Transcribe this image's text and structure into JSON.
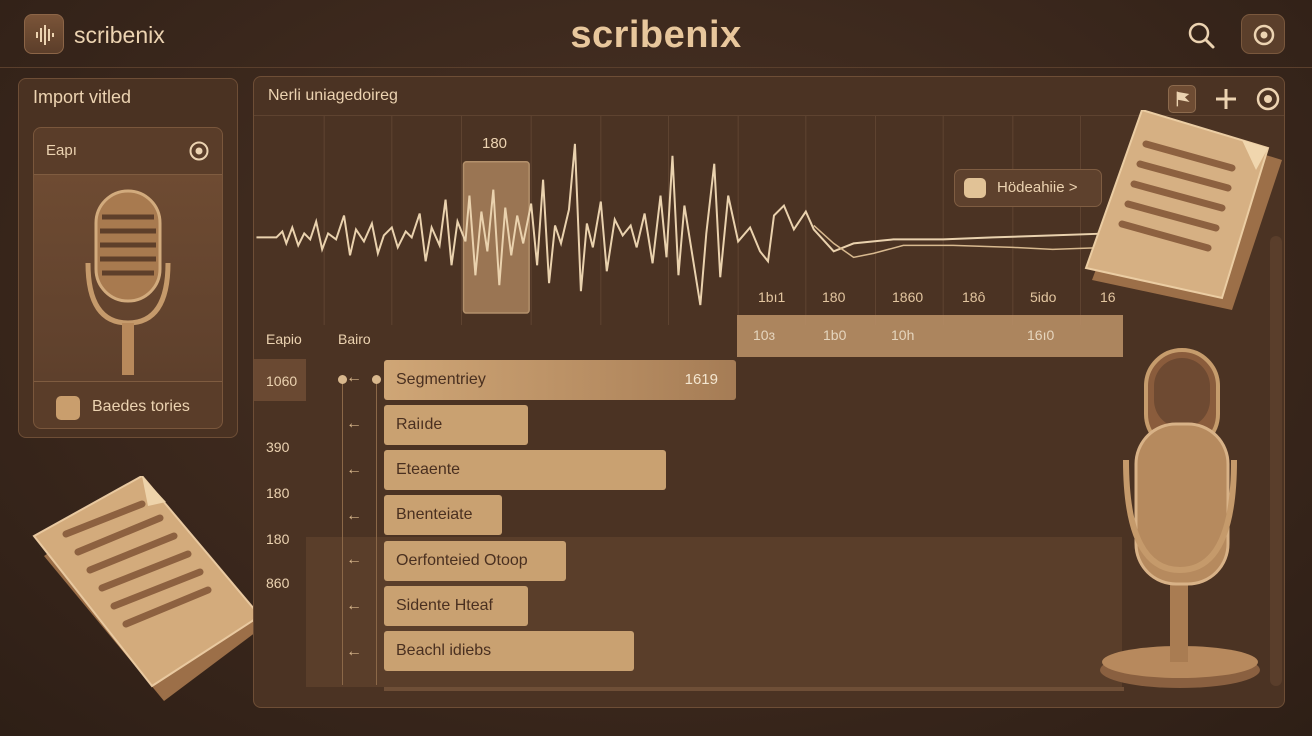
{
  "header": {
    "brand_small": "scribenix",
    "brand_title": "scribenix"
  },
  "left_panel": {
    "title": "Import vitled",
    "card_label": "Eapı",
    "footer_label": "Baedes tories"
  },
  "main_panel": {
    "title": "Nerli uniagedoireg",
    "selection_label": "180",
    "highlight_chip": "Hödeahiie >",
    "time_ticks": [
      "1bı1",
      "180",
      "1860",
      "18ô",
      "5ido",
      "16"
    ],
    "tick_strip": [
      "10ɜ",
      "1b0",
      "10h",
      "16ı0"
    ],
    "column_headers": [
      "Eapio",
      "Bairo"
    ],
    "row_numbers": [
      "1060",
      "390",
      "180",
      "180",
      "860"
    ],
    "segments": [
      {
        "label": "Segmentriey",
        "time": "1619"
      },
      {
        "label": "Raiıde"
      },
      {
        "label": "Eteaente"
      },
      {
        "label": "Bnenteiate"
      },
      {
        "label": "Oerfonteied Otoop"
      },
      {
        "label": "Sidente Hteaf"
      },
      {
        "label": "Beachl idiebs"
      }
    ]
  },
  "icons": [
    "logo-waveform-icon",
    "search-icon",
    "record-icon",
    "target-icon",
    "flag-icon",
    "plus-icon",
    "microphone-icon",
    "document-icon"
  ],
  "colors": {
    "background": "#3a271c",
    "accent": "#c9a171",
    "text": "#ecd3b1"
  }
}
